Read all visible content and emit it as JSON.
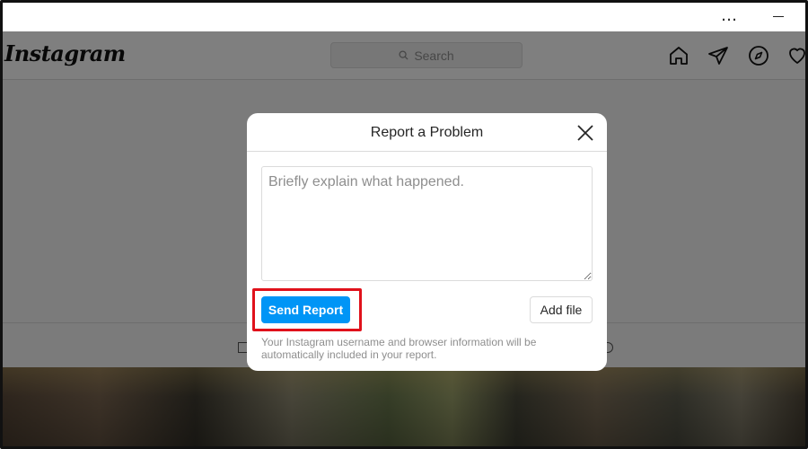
{
  "window": {
    "more_label": "…",
    "icons": [
      "more-icon",
      "minimize-icon"
    ]
  },
  "header": {
    "logo": "Instagram",
    "search_placeholder": "Search",
    "nav_icons": [
      "home-icon",
      "direct-message-icon",
      "explore-compass-icon",
      "heart-icon"
    ]
  },
  "modal": {
    "title": "Report a Problem",
    "textarea_placeholder": "Briefly explain what happened.",
    "textarea_value": "",
    "send_label": "Send Report",
    "add_file_label": "Add file",
    "info": "Your Instagram username and browser information will be automatically included in your report."
  },
  "colors": {
    "primary_button": "#0095f6",
    "highlight_outline": "#e0111b",
    "overlay": "rgba(0,0,0,0.5)"
  }
}
